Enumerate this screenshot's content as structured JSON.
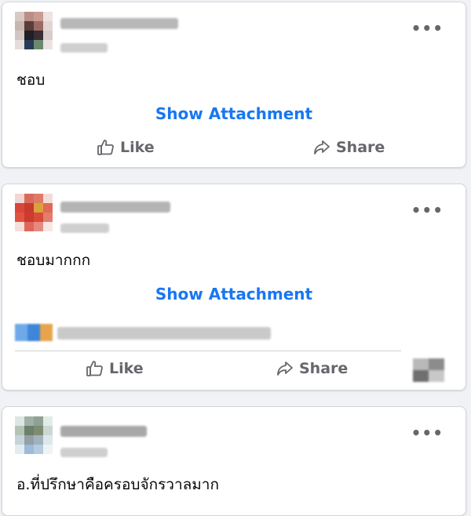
{
  "posts": [
    {
      "text": "ชอบ",
      "attachment_label": "Show Attachment",
      "like_label": "Like",
      "share_label": "Share",
      "more_label": "•••",
      "like_icon": "thumbs-up-icon",
      "share_icon": "share-arrow-icon"
    },
    {
      "text": "ชอบมากกก",
      "attachment_label": "Show Attachment",
      "like_label": "Like",
      "share_label": "Share",
      "more_label": "•••",
      "like_icon": "thumbs-up-icon",
      "share_icon": "share-arrow-icon"
    },
    {
      "text": "อ.ที่ปรึกษาคือครอบจักรวาลมาก",
      "more_label": "•••"
    }
  ],
  "colors": {
    "accent": "#1877f2",
    "secondary_text": "#65676b",
    "background": "#f0f2f5"
  }
}
